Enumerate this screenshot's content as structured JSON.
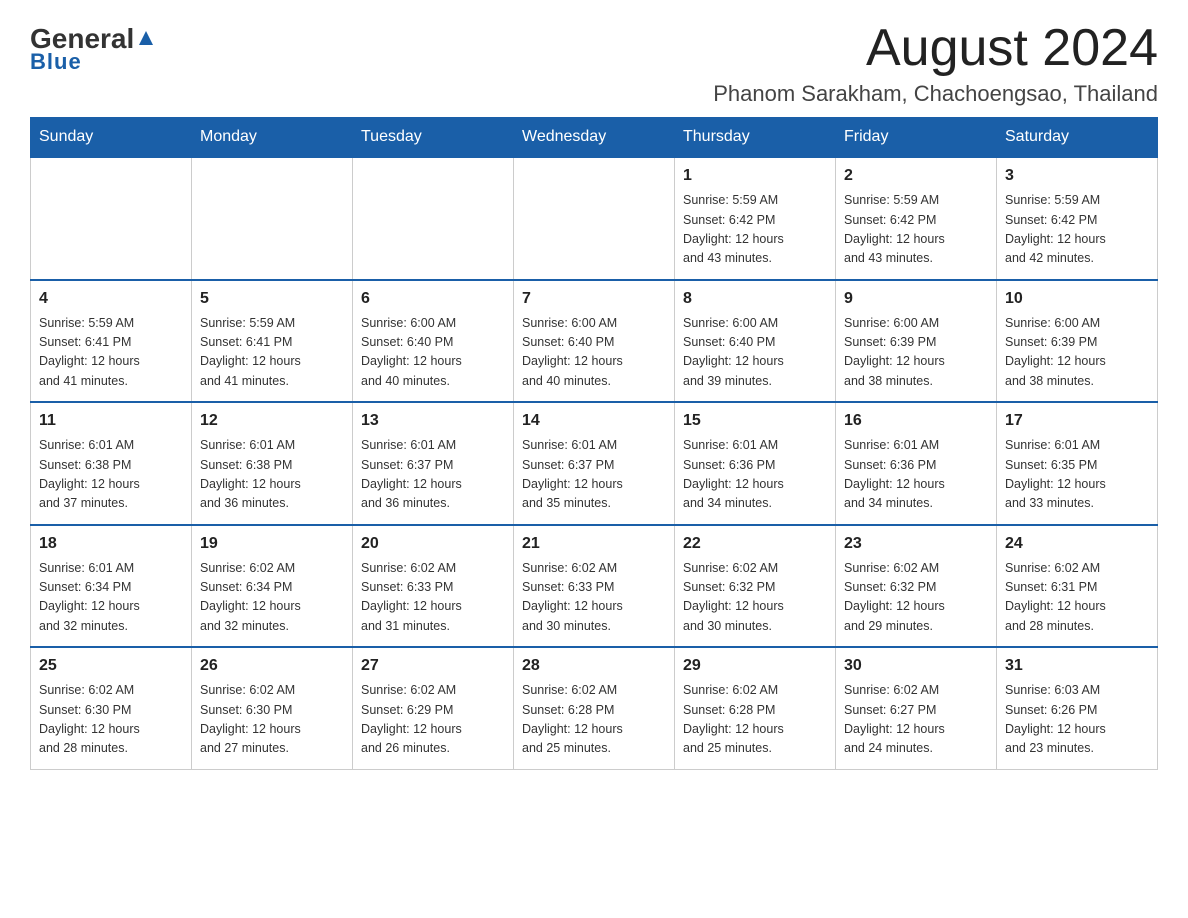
{
  "header": {
    "logo_general": "General",
    "logo_blue": "Blue",
    "title": "August 2024",
    "subtitle": "Phanom Sarakham, Chachoengsao, Thailand"
  },
  "calendar": {
    "days_of_week": [
      "Sunday",
      "Monday",
      "Tuesday",
      "Wednesday",
      "Thursday",
      "Friday",
      "Saturday"
    ],
    "weeks": [
      [
        {
          "day": "",
          "info": ""
        },
        {
          "day": "",
          "info": ""
        },
        {
          "day": "",
          "info": ""
        },
        {
          "day": "",
          "info": ""
        },
        {
          "day": "1",
          "info": "Sunrise: 5:59 AM\nSunset: 6:42 PM\nDaylight: 12 hours\nand 43 minutes."
        },
        {
          "day": "2",
          "info": "Sunrise: 5:59 AM\nSunset: 6:42 PM\nDaylight: 12 hours\nand 43 minutes."
        },
        {
          "day": "3",
          "info": "Sunrise: 5:59 AM\nSunset: 6:42 PM\nDaylight: 12 hours\nand 42 minutes."
        }
      ],
      [
        {
          "day": "4",
          "info": "Sunrise: 5:59 AM\nSunset: 6:41 PM\nDaylight: 12 hours\nand 41 minutes."
        },
        {
          "day": "5",
          "info": "Sunrise: 5:59 AM\nSunset: 6:41 PM\nDaylight: 12 hours\nand 41 minutes."
        },
        {
          "day": "6",
          "info": "Sunrise: 6:00 AM\nSunset: 6:40 PM\nDaylight: 12 hours\nand 40 minutes."
        },
        {
          "day": "7",
          "info": "Sunrise: 6:00 AM\nSunset: 6:40 PM\nDaylight: 12 hours\nand 40 minutes."
        },
        {
          "day": "8",
          "info": "Sunrise: 6:00 AM\nSunset: 6:40 PM\nDaylight: 12 hours\nand 39 minutes."
        },
        {
          "day": "9",
          "info": "Sunrise: 6:00 AM\nSunset: 6:39 PM\nDaylight: 12 hours\nand 38 minutes."
        },
        {
          "day": "10",
          "info": "Sunrise: 6:00 AM\nSunset: 6:39 PM\nDaylight: 12 hours\nand 38 minutes."
        }
      ],
      [
        {
          "day": "11",
          "info": "Sunrise: 6:01 AM\nSunset: 6:38 PM\nDaylight: 12 hours\nand 37 minutes."
        },
        {
          "day": "12",
          "info": "Sunrise: 6:01 AM\nSunset: 6:38 PM\nDaylight: 12 hours\nand 36 minutes."
        },
        {
          "day": "13",
          "info": "Sunrise: 6:01 AM\nSunset: 6:37 PM\nDaylight: 12 hours\nand 36 minutes."
        },
        {
          "day": "14",
          "info": "Sunrise: 6:01 AM\nSunset: 6:37 PM\nDaylight: 12 hours\nand 35 minutes."
        },
        {
          "day": "15",
          "info": "Sunrise: 6:01 AM\nSunset: 6:36 PM\nDaylight: 12 hours\nand 34 minutes."
        },
        {
          "day": "16",
          "info": "Sunrise: 6:01 AM\nSunset: 6:36 PM\nDaylight: 12 hours\nand 34 minutes."
        },
        {
          "day": "17",
          "info": "Sunrise: 6:01 AM\nSunset: 6:35 PM\nDaylight: 12 hours\nand 33 minutes."
        }
      ],
      [
        {
          "day": "18",
          "info": "Sunrise: 6:01 AM\nSunset: 6:34 PM\nDaylight: 12 hours\nand 32 minutes."
        },
        {
          "day": "19",
          "info": "Sunrise: 6:02 AM\nSunset: 6:34 PM\nDaylight: 12 hours\nand 32 minutes."
        },
        {
          "day": "20",
          "info": "Sunrise: 6:02 AM\nSunset: 6:33 PM\nDaylight: 12 hours\nand 31 minutes."
        },
        {
          "day": "21",
          "info": "Sunrise: 6:02 AM\nSunset: 6:33 PM\nDaylight: 12 hours\nand 30 minutes."
        },
        {
          "day": "22",
          "info": "Sunrise: 6:02 AM\nSunset: 6:32 PM\nDaylight: 12 hours\nand 30 minutes."
        },
        {
          "day": "23",
          "info": "Sunrise: 6:02 AM\nSunset: 6:32 PM\nDaylight: 12 hours\nand 29 minutes."
        },
        {
          "day": "24",
          "info": "Sunrise: 6:02 AM\nSunset: 6:31 PM\nDaylight: 12 hours\nand 28 minutes."
        }
      ],
      [
        {
          "day": "25",
          "info": "Sunrise: 6:02 AM\nSunset: 6:30 PM\nDaylight: 12 hours\nand 28 minutes."
        },
        {
          "day": "26",
          "info": "Sunrise: 6:02 AM\nSunset: 6:30 PM\nDaylight: 12 hours\nand 27 minutes."
        },
        {
          "day": "27",
          "info": "Sunrise: 6:02 AM\nSunset: 6:29 PM\nDaylight: 12 hours\nand 26 minutes."
        },
        {
          "day": "28",
          "info": "Sunrise: 6:02 AM\nSunset: 6:28 PM\nDaylight: 12 hours\nand 25 minutes."
        },
        {
          "day": "29",
          "info": "Sunrise: 6:02 AM\nSunset: 6:28 PM\nDaylight: 12 hours\nand 25 minutes."
        },
        {
          "day": "30",
          "info": "Sunrise: 6:02 AM\nSunset: 6:27 PM\nDaylight: 12 hours\nand 24 minutes."
        },
        {
          "day": "31",
          "info": "Sunrise: 6:03 AM\nSunset: 6:26 PM\nDaylight: 12 hours\nand 23 minutes."
        }
      ]
    ]
  }
}
